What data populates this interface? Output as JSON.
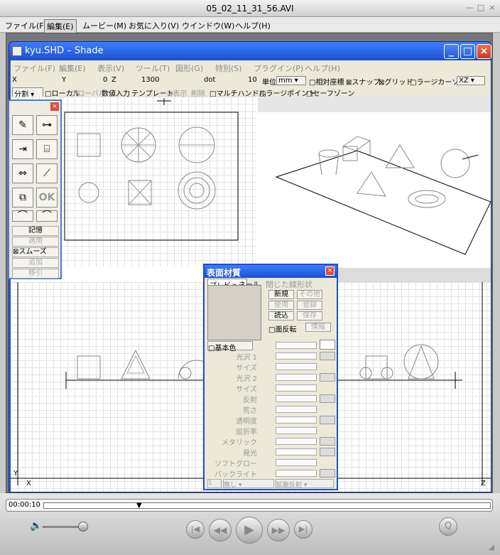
{
  "window": {
    "title": "05_02_11_31_56.AVI",
    "min": "—",
    "max": "□",
    "close": "×"
  },
  "qt_menu": [
    "ファイル(F)",
    "編集(E)",
    "ムービー(M)",
    "お気に入り(V)",
    "ウインドウ(W)",
    "ヘルプ(H)"
  ],
  "shade": {
    "title": "kyu.SHD – Shade",
    "menu": [
      "ファイル(F)",
      "編集(E)",
      "表示(V)",
      "ツール(T)",
      "図形(G)",
      "特別(S)",
      "プラグイン(P)",
      "ヘルプ(H)"
    ],
    "coords": {
      "x": "X",
      "y": "Y",
      "yval": "0",
      "z": "Z",
      "zval": "1300",
      "dot": "dot",
      "dotval": "10",
      "unit_label": "単位",
      "unit": "mm"
    },
    "toolbar1_checks": [
      "□相対座標",
      "⊠スナップ",
      "⊠グリッド",
      "□ラージカーソル"
    ],
    "axis": "XZ",
    "toolbar2": [
      "分割",
      "□ローカル",
      "グローバル",
      "数値入力",
      "テンプレート",
      "⊠表示",
      "削除",
      "□マルチハンドル",
      "□ラージポイント",
      "□セーフゾーン"
    ],
    "toolbox": {
      "close": "×",
      "ok": "OK",
      "buttons": [
        "記憶",
        "適用",
        "⊠スムーズ",
        "追加",
        "移引"
      ]
    },
    "axis_labels": {
      "y": "Y",
      "x": "X",
      "z": "Z"
    }
  },
  "material": {
    "title": "表面材質",
    "close": "×",
    "preview_tab": "プレビュー",
    "tab2": "ネール",
    "tab3": "閉じた線形状",
    "buttons": [
      "新規",
      "その他",
      "使用",
      "登録",
      "読込",
      "保存"
    ],
    "face_flip": "□面反転",
    "info": "情報",
    "base_color": "□基本色",
    "rows": [
      "光沢 1",
      "サイズ",
      "光沢 2",
      "サイズ",
      "反射",
      "荒さ",
      "透明度",
      "屈折率",
      "メタリック",
      "発光",
      "ソフトグロー",
      "バックライト"
    ],
    "bottom": {
      "num": "1",
      "left": "無し",
      "right": "拡散反射"
    }
  },
  "player": {
    "time": "00:00:10"
  }
}
